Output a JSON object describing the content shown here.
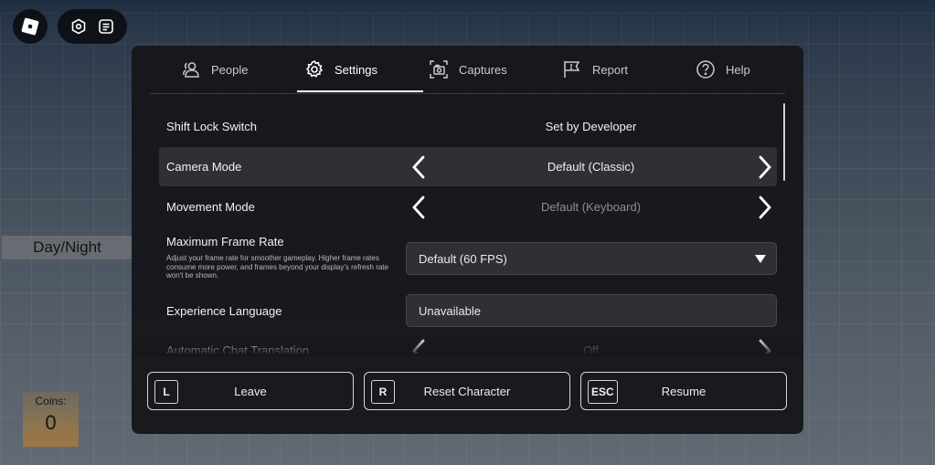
{
  "hud": {
    "roblox_icon": "roblox-logo-icon",
    "capture_icon": "capture-icon",
    "chat_icon": "chat-icon",
    "day_night_label": "Day/Night",
    "coins_label": "Coins:",
    "coins_value": "0"
  },
  "tabs": [
    {
      "label": "People",
      "icon": "people-icon",
      "active": false
    },
    {
      "label": "Settings",
      "icon": "gear-icon",
      "active": true
    },
    {
      "label": "Captures",
      "icon": "camera-icon",
      "active": false
    },
    {
      "label": "Report",
      "icon": "flag-icon",
      "active": false
    },
    {
      "label": "Help",
      "icon": "help-icon",
      "active": false
    }
  ],
  "settings": {
    "shift_lock": {
      "label": "Shift Lock Switch",
      "value": "Set by Developer"
    },
    "camera_mode": {
      "label": "Camera Mode",
      "value": "Default (Classic)"
    },
    "movement_mode": {
      "label": "Movement Mode",
      "value": "Default (Keyboard)"
    },
    "max_frame_rate": {
      "label": "Maximum Frame Rate",
      "description": "Adjust your frame rate for smoother gameplay. Higher frame rates consume more power, and frames beyond your display's refresh rate won't be shown.",
      "value": "Default (60 FPS)"
    },
    "experience_language": {
      "label": "Experience Language",
      "value": "Unavailable"
    },
    "auto_chat_translation": {
      "label": "Automatic Chat Translation",
      "value": "Off"
    }
  },
  "actions": {
    "leave": {
      "key": "L",
      "label": "Leave"
    },
    "reset": {
      "key": "R",
      "label": "Reset Character"
    },
    "resume": {
      "key": "ESC",
      "label": "Resume"
    }
  },
  "colors": {
    "panel": "#16171b",
    "highlight": "#2e3034",
    "text": "#f2f2f2"
  }
}
